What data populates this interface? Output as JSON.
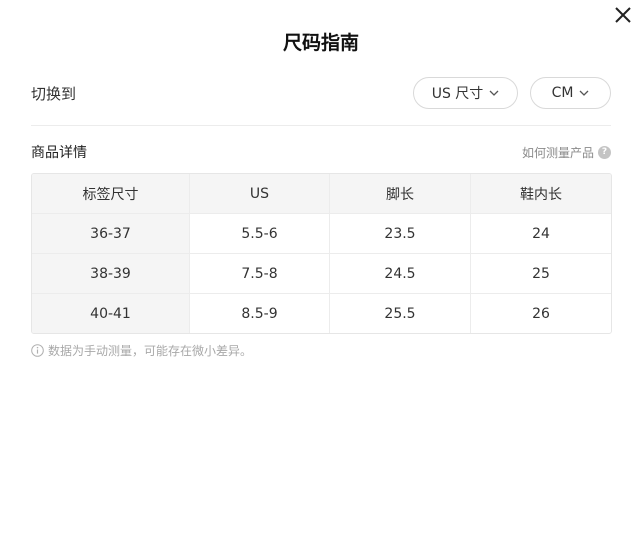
{
  "dialog": {
    "title": "尺码指南",
    "close_icon": "close-icon"
  },
  "switch": {
    "label": "切换到",
    "size_system": "US 尺寸",
    "unit": "CM"
  },
  "details": {
    "title": "商品详情",
    "how_to_measure": "如何测量产品",
    "help_icon": "question-icon",
    "help_glyph": "?"
  },
  "table": {
    "headers": [
      "标签尺寸",
      "US",
      "脚长",
      "鞋内长"
    ],
    "rows": [
      [
        "36-37",
        "5.5-6",
        "23.5",
        "24"
      ],
      [
        "38-39",
        "7.5-8",
        "24.5",
        "25"
      ],
      [
        "40-41",
        "8.5-9",
        "25.5",
        "26"
      ]
    ]
  },
  "note": {
    "icon": "info-icon",
    "text": "数据为手动测量，可能存在微小差异。"
  }
}
